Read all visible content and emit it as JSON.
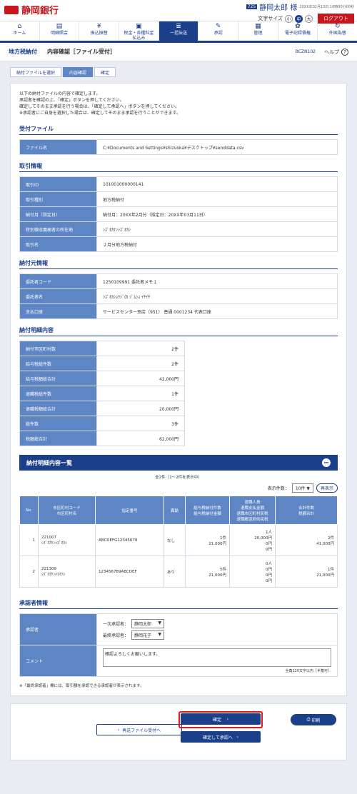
{
  "header": {
    "bank_name": "静岡銀行",
    "user_badge": "725",
    "user_name": "静岡太郎 様",
    "login_time": "20XX年02月13日 10時00分00秒",
    "font_size_label": "文字サイズ",
    "font_sizes": [
      "小",
      "中",
      "大"
    ],
    "logout_label": "ログアウト"
  },
  "gnav": [
    {
      "label": "ホーム",
      "icon": "home-icon",
      "glyph": "⌂"
    },
    {
      "label": "明細照会",
      "icon": "document-icon",
      "glyph": "▤"
    },
    {
      "label": "振込振替",
      "icon": "transfer-icon",
      "glyph": "¥"
    },
    {
      "label": "税金・各種料金\n払込み",
      "icon": "payment-icon",
      "glyph": "▣"
    },
    {
      "label": "一括伝送",
      "icon": "batch-icon",
      "glyph": "≣"
    },
    {
      "label": "承認",
      "icon": "approve-icon",
      "glyph": "✎"
    },
    {
      "label": "管理",
      "icon": "admin-icon",
      "glyph": "▦"
    },
    {
      "label": "電子記録債権",
      "icon": "gear-icon",
      "glyph": "✿"
    },
    {
      "label": "外国為替",
      "icon": "exchange-icon",
      "glyph": "↻"
    }
  ],
  "page": {
    "category": "地方税納付",
    "title": "内容確認［ファイル受付］",
    "code": "BCZN102",
    "help_label": "ヘルプ",
    "steps": [
      "納付ファイルを選択",
      "内容確認",
      "確定"
    ]
  },
  "intro": [
    "以下の納付ファイルの内容で確定します。",
    "承認者を確認の上、「確定」ボタンを押してください。",
    "確定してそのまま承認を行う場合は、「確定して承認へ」ボタンを押してください。",
    "※承認者にご自身を選択した場合は、確定してそのまま承認を行うことができます。"
  ],
  "file_section": {
    "title": "受付ファイル",
    "rows": [
      {
        "k": "ファイル名",
        "v": "C:¥Documents and Settings¥shizuoka¥デスクトップ¥senddata.csv"
      }
    ]
  },
  "trade_section": {
    "title": "取引情報",
    "rows": [
      {
        "k": "取引ID",
        "v": "101001000000141"
      },
      {
        "k": "取引種別",
        "v": "地方税納付"
      },
      {
        "k": "納付月（指定日）",
        "v": "納付月：20XX年2月分（指定日：20XX年03月11日）"
      },
      {
        "k": "特別徴収義務者の所在地",
        "v": "ｼｽﾞｵｶｹﾝｼｽﾞｵｶｼ"
      },
      {
        "k": "取引名",
        "v": "２月分地方税納付"
      }
    ]
  },
  "payer_section": {
    "title": "納付元情報",
    "rows": [
      {
        "k": "委託者コード",
        "v": "1250109991 委託者メモ１"
      },
      {
        "k": "委託者名",
        "v": "ｼｽﾞｵｶｼｮｳｼﾞ(ｶ ｼﾞﾑｼｮ ｲﾁｲﾁ"
      },
      {
        "k": "支払口座",
        "v": "サービスセンター支店（951） 普通 0001234 代表口座"
      }
    ]
  },
  "summary_section": {
    "title": "納付明細内容",
    "rows": [
      {
        "k": "納付市区町村数",
        "v": "2件"
      },
      {
        "k": "給与税総件数",
        "v": "2件"
      },
      {
        "k": "給与税額総合計",
        "v": "42,000円"
      },
      {
        "k": "退職税総件数",
        "v": "1件"
      },
      {
        "k": "退職税額総合計",
        "v": "20,000円"
      },
      {
        "k": "総件数",
        "v": "3件"
      },
      {
        "k": "税額総合計",
        "v": "62,000円"
      }
    ]
  },
  "detail_list": {
    "title": "納付明細内容一覧",
    "count_text": "全2件（1～2件を表示中）",
    "display_label": "表示件数：",
    "display_value": "10件",
    "redisplay_label": "再表示",
    "headers": [
      "No.",
      "市区町村コード\n市区町村名",
      "指定番号",
      "異動",
      "給与税納付件数\n給与税納付金額",
      "退職人員\n退職支払金額\n退職市区町村民税\n退職都道府県民税",
      "合計件数\n税額合計"
    ],
    "rows": [
      {
        "no": "1",
        "code": "221007",
        "name": "ｼｽﾞｵｶｹﾝｼｽﾞｵｶｼ",
        "spec": "ABCDEFG12345678",
        "change": "なし",
        "sal_count": "1件",
        "sal_amount": "21,000円",
        "ret_persons": "1人",
        "ret_pay": "20,000円",
        "ret_city": "0円",
        "ret_pref": "0円",
        "total_count": "2件",
        "total_amount": "41,000円"
      },
      {
        "no": "2",
        "code": "221309",
        "name": "ｼｽﾞｵｶｹﾝﾊﾏﾏﾂｼ",
        "spec": "123456789ABCDEF",
        "change": "あり",
        "sal_count": "5件",
        "sal_amount": "21,000円",
        "ret_persons": "0人",
        "ret_pay": "0円",
        "ret_city": "0円",
        "ret_pref": "0円",
        "total_count": "1件",
        "total_amount": "21,000円"
      }
    ]
  },
  "approver_section": {
    "title": "承認者情報",
    "approver_label": "承認者",
    "first_label": "一次承認者：",
    "first_value": "静岡太郎",
    "final_label": "最終承認者：",
    "final_value": "静岡花子",
    "comment_label": "コメント",
    "comment_value": "確認よろしくお願いします。",
    "comment_note": "全角120文字以内［半角可］"
  },
  "note": "※「最終承認者」欄には、取引額を承認できる承認者が表示されます。",
  "buttons": {
    "back": "再送ファイル受付へ",
    "confirm": "確定",
    "confirm_approve": "確定して承認へ",
    "print": "印刷"
  }
}
